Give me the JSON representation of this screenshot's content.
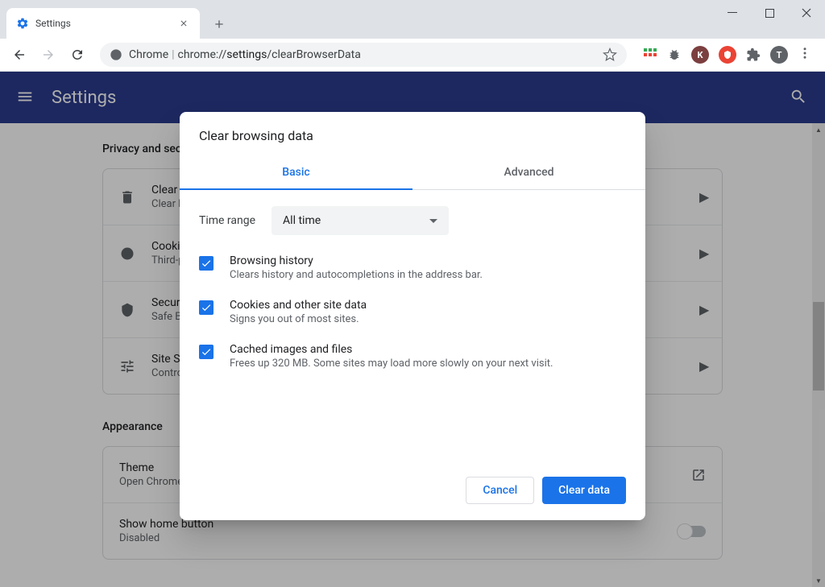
{
  "window": {
    "tab_title": "Settings"
  },
  "omnibox": {
    "prefix": "Chrome",
    "url_prefix": "chrome://",
    "url_bold": "settings",
    "url_suffix": "/clearBrowserData"
  },
  "header": {
    "title": "Settings"
  },
  "sections": {
    "privacy_title": "Privacy and security",
    "appearance_title": "Appearance"
  },
  "privacy_rows": [
    {
      "title": "Clear browsing data",
      "sub": "Clear history, cookies, cache, and more"
    },
    {
      "title": "Cookies and other site data",
      "sub": "Third-party cookies are blocked in Incognito mode"
    },
    {
      "title": "Security",
      "sub": "Safe Browsing (protection from dangerous sites) and other security settings"
    },
    {
      "title": "Site Settings",
      "sub": "Controls what information sites can use and show"
    }
  ],
  "appearance_rows": [
    {
      "title": "Theme",
      "sub": "Open Chrome Web Store"
    },
    {
      "title": "Show home button",
      "sub": "Disabled"
    }
  ],
  "dialog": {
    "title": "Clear browsing data",
    "tab_basic": "Basic",
    "tab_advanced": "Advanced",
    "time_label": "Time range",
    "time_value": "All time",
    "items": [
      {
        "title": "Browsing history",
        "sub": "Clears history and autocompletions in the address bar."
      },
      {
        "title": "Cookies and other site data",
        "sub": "Signs you out of most sites."
      },
      {
        "title": "Cached images and files",
        "sub": "Frees up 320 MB. Some sites may load more slowly on your next visit."
      }
    ],
    "cancel": "Cancel",
    "confirm": "Clear data"
  },
  "profile_letter": "T"
}
